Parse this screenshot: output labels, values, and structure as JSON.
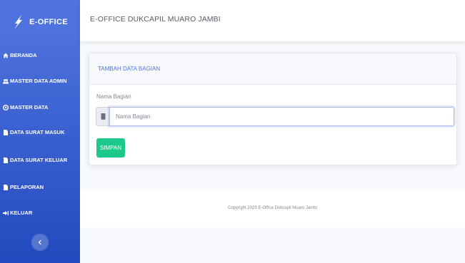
{
  "brand": {
    "name": "E-OFFICE",
    "icon": "feather-icon"
  },
  "sidebar": {
    "items": [
      {
        "label": "BERANDA",
        "icon": "home-icon"
      },
      {
        "label": "MASTER DATA ADMIN",
        "icon": "users-icon"
      },
      {
        "label": "MASTER DATA",
        "icon": "database-icon"
      },
      {
        "label": "DATA SURAT MASUK",
        "icon": "file-icon"
      },
      {
        "label": "DATA SURAT KELUAR",
        "icon": "file-icon"
      },
      {
        "label": "PELAPORAN",
        "icon": "file-icon"
      },
      {
        "label": "KELUAR",
        "icon": "sign-out-icon"
      }
    ],
    "toggle_icon": "chevron-left-icon"
  },
  "topbar": {
    "title": "E-OFFICE DUKCAPIL MUARO JAMBI"
  },
  "card": {
    "title": "TAMBAH DATA BAGIAN",
    "field_label": "Nama Bagian",
    "field_placeholder": "Nama Bagian",
    "field_value": "",
    "field_icon": "book-icon",
    "submit_label": "SIMPAN"
  },
  "footer": {
    "copyright": "Copyright 2023 E-Office Dukcapil Muaro Jambi"
  },
  "colors": {
    "primary": "#4e73df",
    "primary_dark": "#224abe",
    "success": "#1cc88a",
    "muted_text": "#858796",
    "background": "#f8f9fc"
  }
}
